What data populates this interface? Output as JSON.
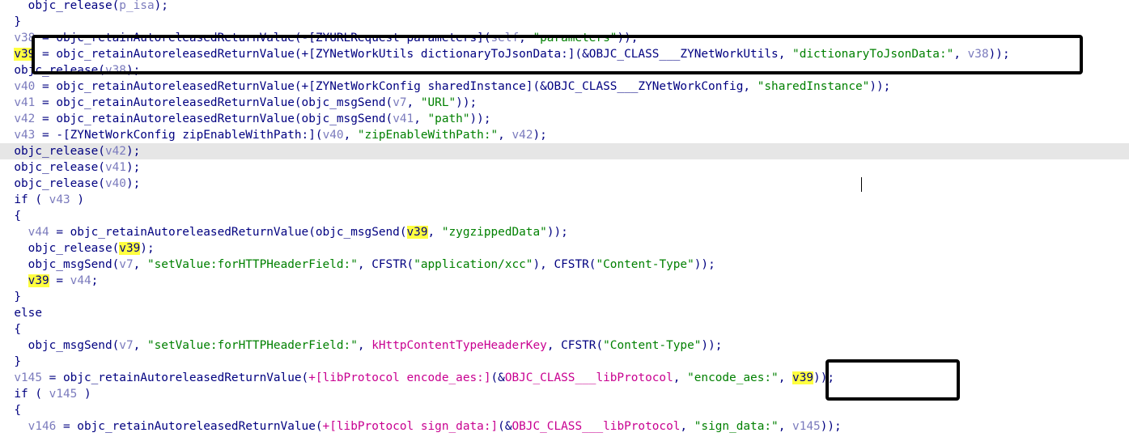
{
  "editor": {
    "current_line_index": 9,
    "colors": {
      "default": "#000080",
      "variable": "#7b7bbd",
      "string": "#008000",
      "import": "#c80090",
      "highlight": "#ffff40",
      "current_line_bg": "#e6e6e6"
    },
    "lines": [
      {
        "segments": [
          {
            "t": "    ",
            "c": "def"
          },
          {
            "t": "objc_release(",
            "c": "def"
          },
          {
            "t": "p_isa",
            "c": "var"
          },
          {
            "t": ");",
            "c": "def"
          }
        ]
      },
      {
        "segments": [
          {
            "t": "  }",
            "c": "def"
          }
        ]
      },
      {
        "segments": [
          {
            "t": "  ",
            "c": "def"
          },
          {
            "t": "v38",
            "c": "var"
          },
          {
            "t": " = objc_retainAutoreleasedReturnValue(-[ZYURLRequest parameters](",
            "c": "def"
          },
          {
            "t": "self",
            "c": "var"
          },
          {
            "t": ", ",
            "c": "def"
          },
          {
            "t": "\"parameters\"",
            "c": "str"
          },
          {
            "t": "));",
            "c": "def"
          }
        ]
      },
      {
        "segments": [
          {
            "t": "  ",
            "c": "def"
          },
          {
            "t": "v39",
            "c": "hl"
          },
          {
            "t": " = objc_retainAutoreleasedReturnValue(+[ZYNetWorkUtils dictionaryToJsonData:](&OBJC_CLASS___ZYNetWorkUtils, ",
            "c": "def"
          },
          {
            "t": "\"dictionaryToJsonData:\"",
            "c": "str"
          },
          {
            "t": ", ",
            "c": "def"
          },
          {
            "t": "v38",
            "c": "var"
          },
          {
            "t": "));",
            "c": "def"
          }
        ]
      },
      {
        "segments": [
          {
            "t": "  objc_release(",
            "c": "def"
          },
          {
            "t": "v38",
            "c": "var"
          },
          {
            "t": ");",
            "c": "def"
          }
        ]
      },
      {
        "segments": [
          {
            "t": "  ",
            "c": "def"
          },
          {
            "t": "v40",
            "c": "var"
          },
          {
            "t": " = objc_retainAutoreleasedReturnValue(+[ZYNetWorkConfig sharedInstance](&OBJC_CLASS___ZYNetWorkConfig, ",
            "c": "def"
          },
          {
            "t": "\"sharedInstance\"",
            "c": "str"
          },
          {
            "t": "));",
            "c": "def"
          }
        ]
      },
      {
        "segments": [
          {
            "t": "  ",
            "c": "def"
          },
          {
            "t": "v41",
            "c": "var"
          },
          {
            "t": " = objc_retainAutoreleasedReturnValue(objc_msgSend(",
            "c": "def"
          },
          {
            "t": "v7",
            "c": "var"
          },
          {
            "t": ", ",
            "c": "def"
          },
          {
            "t": "\"URL\"",
            "c": "str"
          },
          {
            "t": "));",
            "c": "def"
          }
        ]
      },
      {
        "segments": [
          {
            "t": "  ",
            "c": "def"
          },
          {
            "t": "v42",
            "c": "var"
          },
          {
            "t": " = objc_retainAutoreleasedReturnValue(objc_msgSend(",
            "c": "def"
          },
          {
            "t": "v41",
            "c": "var"
          },
          {
            "t": ", ",
            "c": "def"
          },
          {
            "t": "\"path\"",
            "c": "str"
          },
          {
            "t": "));",
            "c": "def"
          }
        ]
      },
      {
        "segments": [
          {
            "t": "  ",
            "c": "def"
          },
          {
            "t": "v43",
            "c": "var"
          },
          {
            "t": " = -[ZYNetWorkConfig zipEnableWithPath:](",
            "c": "def"
          },
          {
            "t": "v40",
            "c": "var"
          },
          {
            "t": ", ",
            "c": "def"
          },
          {
            "t": "\"zipEnableWithPath:\"",
            "c": "str"
          },
          {
            "t": ", ",
            "c": "def"
          },
          {
            "t": "v42",
            "c": "var"
          },
          {
            "t": ");",
            "c": "def"
          }
        ]
      },
      {
        "segments": [
          {
            "t": "  objc_release(",
            "c": "def"
          },
          {
            "t": "v42",
            "c": "var"
          },
          {
            "t": ");",
            "c": "def"
          }
        ]
      },
      {
        "segments": [
          {
            "t": "  objc_release(",
            "c": "def"
          },
          {
            "t": "v41",
            "c": "var"
          },
          {
            "t": ");",
            "c": "def"
          }
        ]
      },
      {
        "segments": [
          {
            "t": "  objc_release(",
            "c": "def"
          },
          {
            "t": "v40",
            "c": "var"
          },
          {
            "t": ");",
            "c": "def"
          }
        ]
      },
      {
        "segments": [
          {
            "t": "  if ( ",
            "c": "def"
          },
          {
            "t": "v43",
            "c": "var"
          },
          {
            "t": " )",
            "c": "def"
          }
        ]
      },
      {
        "segments": [
          {
            "t": "  {",
            "c": "def"
          }
        ]
      },
      {
        "segments": [
          {
            "t": "    ",
            "c": "def"
          },
          {
            "t": "v44",
            "c": "var"
          },
          {
            "t": " = objc_retainAutoreleasedReturnValue(objc_msgSend(",
            "c": "def"
          },
          {
            "t": "v39",
            "c": "hl"
          },
          {
            "t": ", ",
            "c": "def"
          },
          {
            "t": "\"zygzippedData\"",
            "c": "str"
          },
          {
            "t": "));",
            "c": "def"
          }
        ]
      },
      {
        "segments": [
          {
            "t": "    objc_release(",
            "c": "def"
          },
          {
            "t": "v39",
            "c": "hl"
          },
          {
            "t": ");",
            "c": "def"
          }
        ]
      },
      {
        "segments": [
          {
            "t": "    objc_msgSend(",
            "c": "def"
          },
          {
            "t": "v7",
            "c": "var"
          },
          {
            "t": ", ",
            "c": "def"
          },
          {
            "t": "\"setValue:forHTTPHeaderField:\"",
            "c": "str"
          },
          {
            "t": ", CFSTR(",
            "c": "def"
          },
          {
            "t": "\"application/xcc\"",
            "c": "str"
          },
          {
            "t": "), CFSTR(",
            "c": "def"
          },
          {
            "t": "\"Content-Type\"",
            "c": "str"
          },
          {
            "t": "));",
            "c": "def"
          }
        ]
      },
      {
        "segments": [
          {
            "t": "    ",
            "c": "def"
          },
          {
            "t": "v39",
            "c": "hl"
          },
          {
            "t": " = ",
            "c": "def"
          },
          {
            "t": "v44",
            "c": "var"
          },
          {
            "t": ";",
            "c": "def"
          }
        ]
      },
      {
        "segments": [
          {
            "t": "  }",
            "c": "def"
          }
        ]
      },
      {
        "segments": [
          {
            "t": "  else",
            "c": "def"
          }
        ]
      },
      {
        "segments": [
          {
            "t": "  {",
            "c": "def"
          }
        ]
      },
      {
        "segments": [
          {
            "t": "    objc_msgSend(",
            "c": "def"
          },
          {
            "t": "v7",
            "c": "var"
          },
          {
            "t": ", ",
            "c": "def"
          },
          {
            "t": "\"setValue:forHTTPHeaderField:\"",
            "c": "str"
          },
          {
            "t": ", ",
            "c": "def"
          },
          {
            "t": "kHttpContentTypeHeaderKey",
            "c": "imp"
          },
          {
            "t": ", CFSTR(",
            "c": "def"
          },
          {
            "t": "\"Content-Type\"",
            "c": "str"
          },
          {
            "t": "));",
            "c": "def"
          }
        ]
      },
      {
        "segments": [
          {
            "t": "  }",
            "c": "def"
          }
        ]
      },
      {
        "segments": [
          {
            "t": "  ",
            "c": "def"
          },
          {
            "t": "v145",
            "c": "var"
          },
          {
            "t": " = objc_retainAutoreleasedReturnValue(",
            "c": "def"
          },
          {
            "t": "+[libProtocol encode_aes:]",
            "c": "imp"
          },
          {
            "t": "(&",
            "c": "def"
          },
          {
            "t": "OBJC_CLASS___libProtocol",
            "c": "imp"
          },
          {
            "t": ", ",
            "c": "def"
          },
          {
            "t": "\"encode_aes:\"",
            "c": "str"
          },
          {
            "t": ", ",
            "c": "def"
          },
          {
            "t": "v39",
            "c": "hl"
          },
          {
            "t": "));",
            "c": "def"
          }
        ]
      },
      {
        "segments": [
          {
            "t": "  if ( ",
            "c": "def"
          },
          {
            "t": "v145",
            "c": "var"
          },
          {
            "t": " )",
            "c": "def"
          }
        ]
      },
      {
        "segments": [
          {
            "t": "  {",
            "c": "def"
          }
        ]
      },
      {
        "segments": [
          {
            "t": "    ",
            "c": "def"
          },
          {
            "t": "v146",
            "c": "var"
          },
          {
            "t": " = objc_retainAutoreleasedReturnValue(",
            "c": "def"
          },
          {
            "t": "+[libProtocol sign_data:]",
            "c": "imp"
          },
          {
            "t": "(&",
            "c": "def"
          },
          {
            "t": "OBJC_CLASS___libProtocol",
            "c": "imp"
          },
          {
            "t": ", ",
            "c": "def"
          },
          {
            "t": "\"sign_data:\"",
            "c": "str"
          },
          {
            "t": ", ",
            "c": "def"
          },
          {
            "t": "v145",
            "c": "var"
          },
          {
            "t": "));",
            "c": "def"
          }
        ]
      }
    ]
  }
}
